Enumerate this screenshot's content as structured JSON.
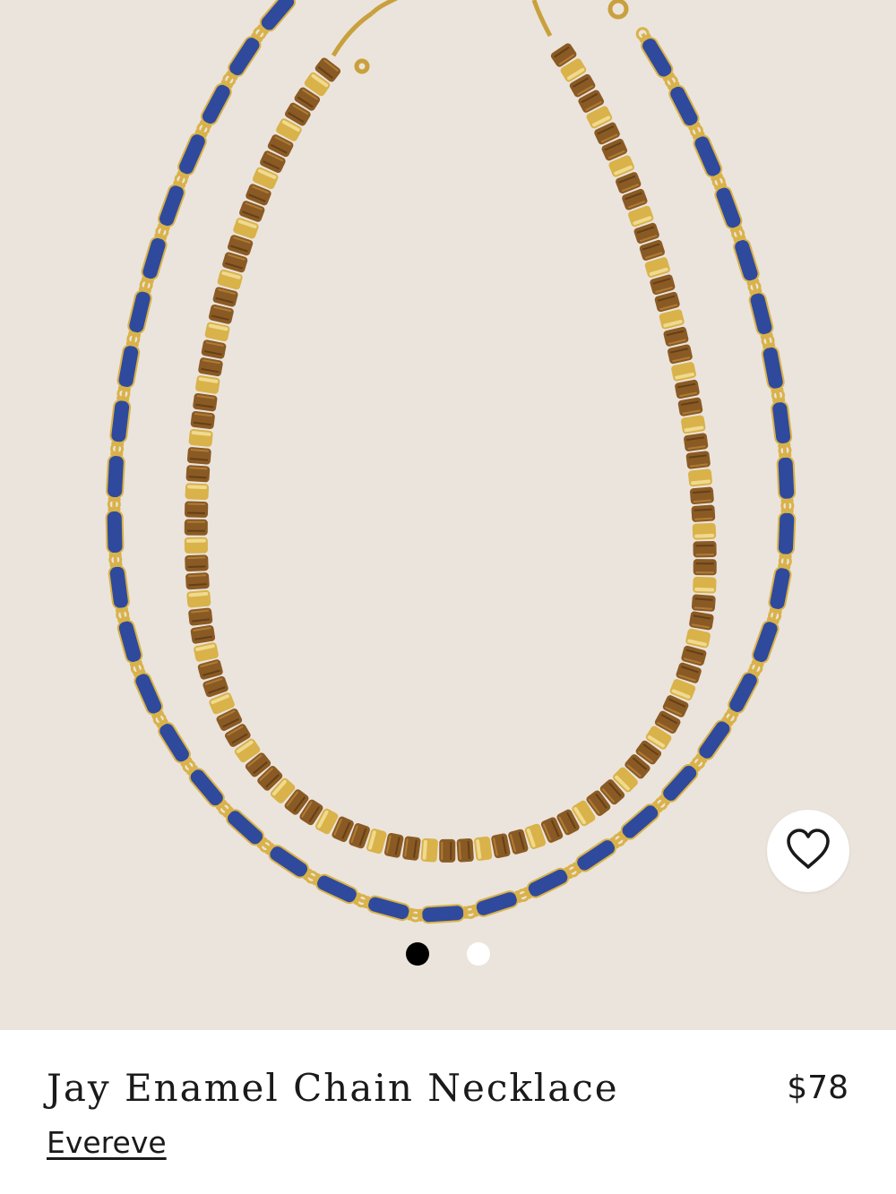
{
  "product": {
    "title": "Jay Enamel Chain Necklace",
    "price": "$78",
    "brand": "Evereve"
  },
  "gallery": {
    "slide_count": 2,
    "active_index": 0
  },
  "icons": {
    "favorite": "heart-outline-icon"
  },
  "colors": {
    "image_background": "#ebe4dc",
    "enamel_blue": "#2f4a9c",
    "gold": "#d9b24a",
    "tiger_eye": "#8a5a24",
    "text": "#1a1a1a"
  }
}
